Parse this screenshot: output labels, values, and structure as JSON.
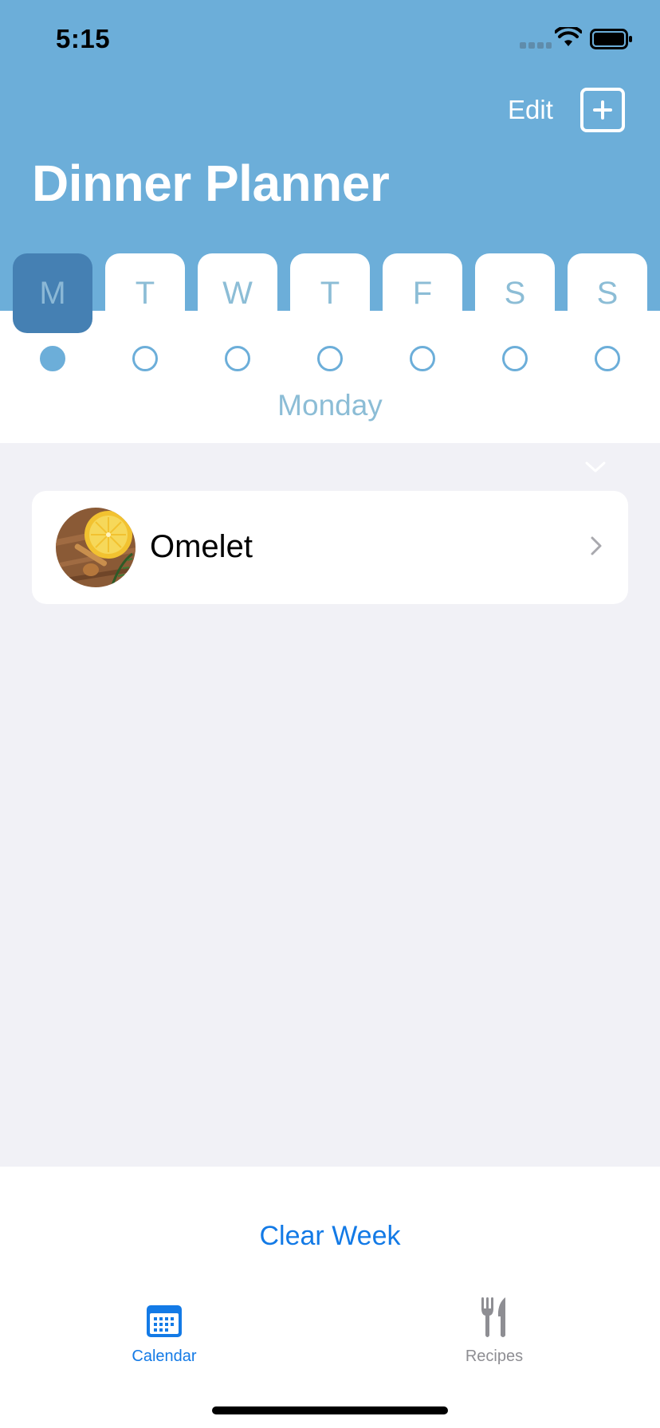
{
  "status_bar": {
    "time": "5:15"
  },
  "header": {
    "edit_label": "Edit",
    "title": "Dinner Planner",
    "background_color": "#6caed9"
  },
  "week": {
    "days": [
      "M",
      "T",
      "W",
      "T",
      "F",
      "S",
      "S"
    ],
    "selected_index": 0,
    "selected_day_name": "Monday"
  },
  "meals": [
    {
      "name": "Omelet",
      "image_icon": "lemon-honey-photo"
    }
  ],
  "actions": {
    "clear_week_label": "Clear Week"
  },
  "tab_bar": {
    "tabs": [
      {
        "label": "Calendar",
        "icon": "calendar-icon",
        "active": true,
        "color": "#137ae6"
      },
      {
        "label": "Recipes",
        "icon": "fork-knife-icon",
        "active": false,
        "color": "#8e8e93"
      }
    ]
  }
}
